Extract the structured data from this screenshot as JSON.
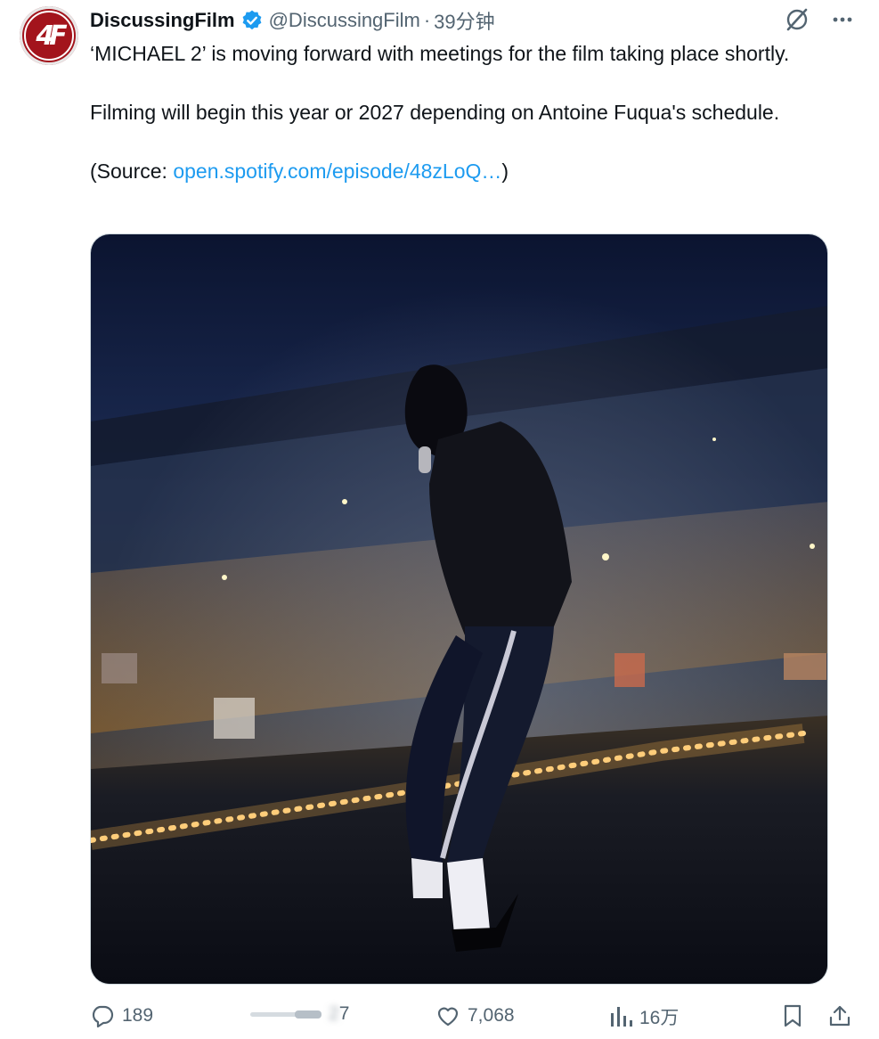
{
  "author": {
    "name": "DiscussingFilm",
    "handle": "@DiscussingFilm",
    "separator": "·",
    "time": "39分钟",
    "avatar_text": "4F"
  },
  "tweet": {
    "line1": "‘MICHAEL 2’ is moving forward with meetings for the film taking place shortly.",
    "line2": "Filming will begin this year or 2027 depending on Antoine Fuqua's schedule.",
    "source_prefix": "(Source: ",
    "source_link": "open.spotify.com/episode/48zLoQ…",
    "source_suffix": ")"
  },
  "actions": {
    "replies": "189",
    "reposts": "7",
    "likes": "7,068",
    "views": "16万"
  },
  "colors": {
    "link": "#1d9bf0",
    "verified": "#1d9bf0",
    "muted": "#536471",
    "avatar_bg": "#a3141c"
  },
  "icons": [
    "grok-icon",
    "more-icon",
    "verified-badge-icon",
    "reply-icon",
    "repost-icon",
    "like-icon",
    "views-icon",
    "bookmark-icon",
    "share-icon"
  ]
}
